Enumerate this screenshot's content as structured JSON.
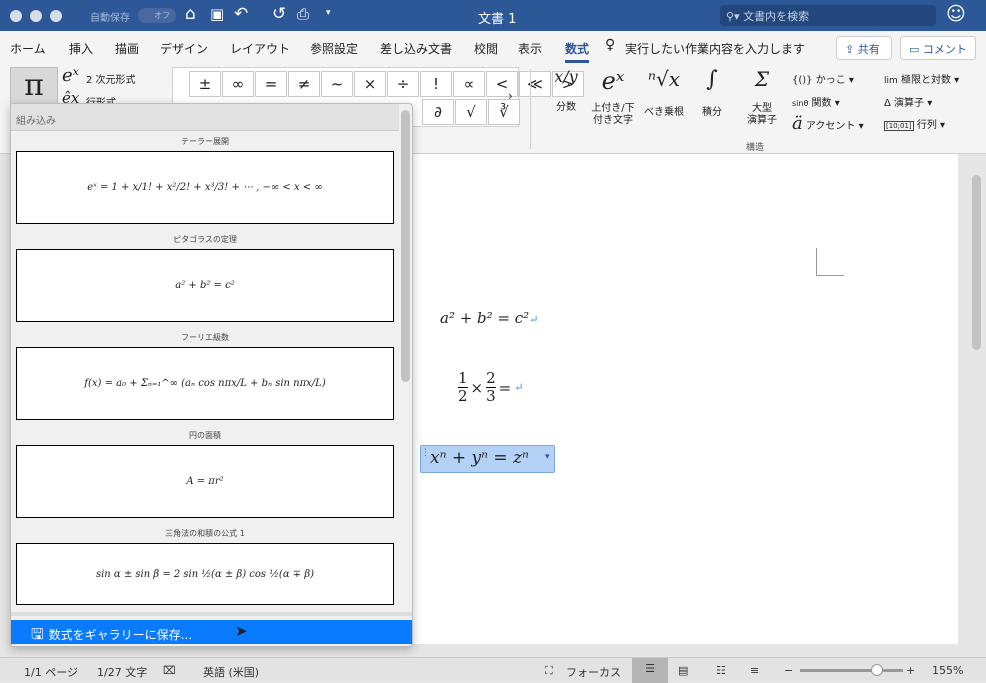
{
  "titlebar": {
    "autosave": "自動保存",
    "autosave_state": "オフ",
    "title": "文書 1",
    "search_placeholder": "文書内を検索"
  },
  "tabs": [
    "ホーム",
    "挿入",
    "描画",
    "デザイン",
    "レイアウト",
    "参照設定",
    "差し込み文書",
    "校閲",
    "表示",
    "数式"
  ],
  "active_tab": "数式",
  "tell_me": "実行したい作業内容を入力します",
  "share": "共有",
  "comment": "コメント",
  "ribbon": {
    "equation_icon": "π",
    "professional": "2 次元形式",
    "linear": "行形式",
    "symbols_row1": [
      "±",
      "∞",
      "=",
      "≠",
      "~",
      "×",
      "÷",
      "!",
      "∝",
      "<",
      "≪",
      ">"
    ],
    "symbols_row2_visible": [
      "∂",
      "√",
      "∛"
    ],
    "structures": [
      {
        "label": "分数",
        "glyph": "x/y"
      },
      {
        "label": "上付き/下\n付き文字",
        "glyph": "eˣ"
      },
      {
        "label": "べき乗根",
        "glyph": "ⁿ√x"
      },
      {
        "label": "積分",
        "glyph": "∫"
      },
      {
        "label": "大型\n演算子",
        "glyph": "Σ"
      }
    ],
    "small_structs": [
      {
        "label": "かっこ",
        "glyph": "{()}"
      },
      {
        "label": "関数",
        "glyph": "sinθ"
      },
      {
        "label": "アクセント",
        "glyph": "ä"
      },
      {
        "label": "極限と対数",
        "glyph": "lim"
      },
      {
        "label": "演算子",
        "glyph": "Δ"
      },
      {
        "label": "行列",
        "glyph": "[10;01]"
      }
    ],
    "group_label": "構造"
  },
  "gallery": {
    "header": "組み込み",
    "items": [
      {
        "title": "テーラー展開",
        "formula": "eˣ = 1 + x/1! + x²/2! + x³/3! + ⋯ ,     −∞ < x < ∞"
      },
      {
        "title": "ピタゴラスの定理",
        "formula": "a² + b² = c²"
      },
      {
        "title": "フーリエ級数",
        "formula": "f(x) = a₀ + Σₙ₌₁^∞ (aₙ cos nπx/L + bₙ sin nπx/L)"
      },
      {
        "title": "円の面積",
        "formula": "A = πr²"
      },
      {
        "title": "三角法の和積の公式 1",
        "formula": "sin α ± sin β = 2 sin ½(α ± β) cos ½(α ∓ β)"
      }
    ],
    "save_label": "数式をギャラリーに保存..."
  },
  "document": {
    "eq1": "a² + b² = c²",
    "eq2_a": "1",
    "eq2_b": "2",
    "eq2_c": "2",
    "eq2_d": "3",
    "eq2_op": "×",
    "eq2_eq": "=",
    "eq3": "𝑥ⁿ + 𝑦ⁿ = 𝑧ⁿ"
  },
  "status": {
    "page": "1/1 ページ",
    "words": "1/27 文字",
    "language": "英語 (米国)",
    "focus": "フォーカス",
    "zoom": "155%",
    "zoom_percent": 155
  },
  "colors": {
    "titlebar": "#2c5898",
    "accent": "#2b579a",
    "selection": "#0a7aff"
  }
}
